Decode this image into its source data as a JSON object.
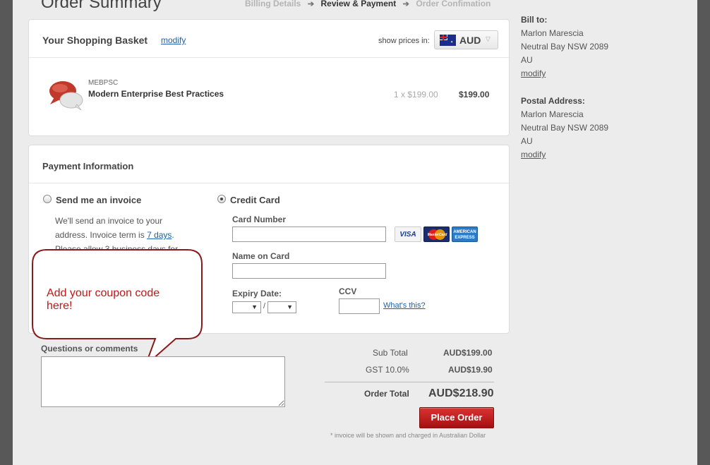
{
  "header": {
    "title": "Order Summary",
    "steps": [
      "Billing Details",
      "Review & Payment",
      "Order Confimation"
    ]
  },
  "basket": {
    "title": "Your Shopping Basket",
    "modify_label": "modify",
    "show_prices_label": "show prices in:",
    "currency": "AUD",
    "item": {
      "code": "MEBPSC",
      "name": "Modern Enterprise Best Practices",
      "qty_price": "1 x $199.00",
      "total": "$199.00"
    }
  },
  "payment": {
    "title": "Payment Information",
    "invoice_label": "Send me an invoice",
    "invoice_text_1": "We'll send an invoice to your",
    "invoice_text_2": "address. Invoice term is",
    "invoice_term": "7 days",
    "invoice_text_3": "Please allow 3 business days for",
    "credit_label": "Credit Card",
    "card_number_label": "Card Number",
    "name_on_card_label": "Name on Card",
    "expiry_label": "Expiry Date:",
    "expiry_sep": "/",
    "ccv_label": "CCV",
    "whats_this": "What's this?",
    "cards": [
      "VISA",
      "MasterCard",
      "AMERICAN EXPRESS"
    ]
  },
  "callout": {
    "text": "Add your coupon code here!"
  },
  "comments": {
    "label": "Questions or comments"
  },
  "totals": {
    "subtotal_label": "Sub Total",
    "subtotal_value": "AUD$199.00",
    "gst_label": "GST 10.0%",
    "gst_value": "AUD$19.90",
    "order_total_label": "Order Total",
    "order_total_value": "AUD$218.90",
    "place_order": "Place Order",
    "note": "* invoice will be shown and charged in Australian Dollar"
  },
  "sidebar": {
    "bill_to_label": "Bill to:",
    "bill_name": "Marlon Marescia",
    "bill_city": "Neutral Bay NSW 2089",
    "bill_country": "AU",
    "postal_label": "Postal Address:",
    "postal_name": "Marlon Marescia",
    "postal_city": "Neutral Bay NSW 2089",
    "postal_country": "AU",
    "modify_label": "modify"
  }
}
